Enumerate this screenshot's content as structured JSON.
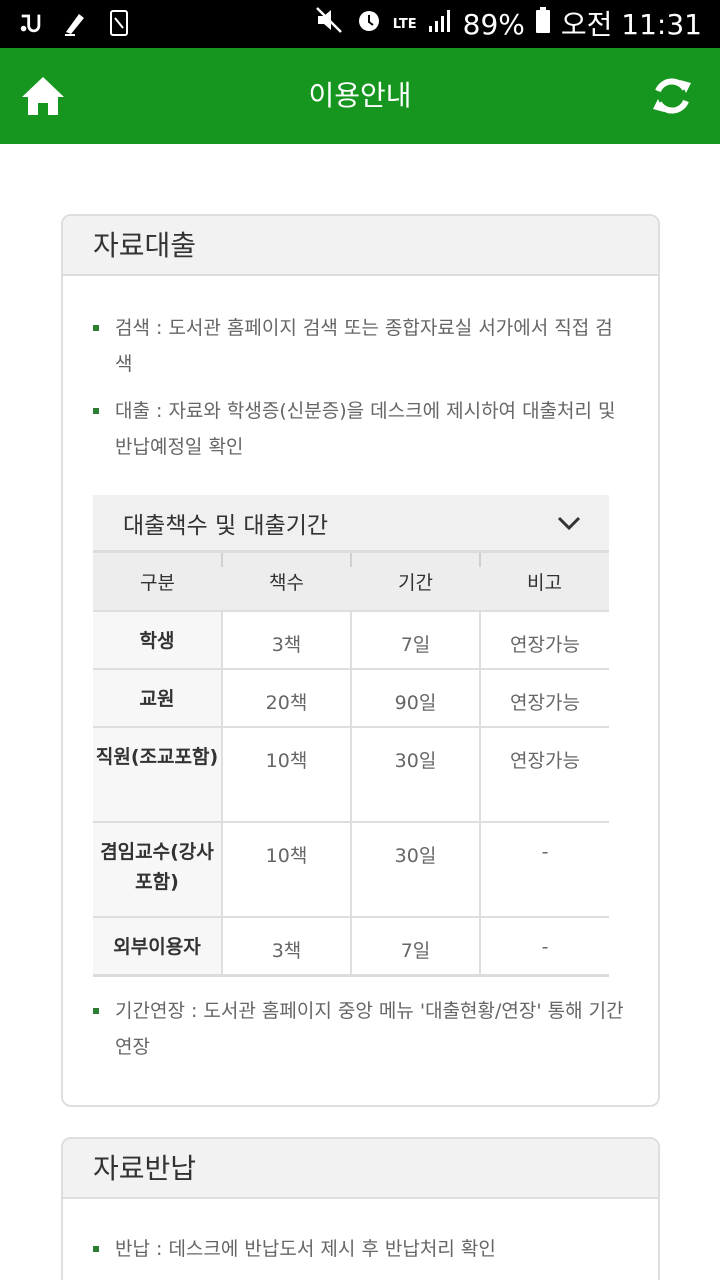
{
  "statusbar": {
    "battery": "89%",
    "time": "오전 11:31",
    "network": "LTE"
  },
  "appbar": {
    "title": "이용안내",
    "home_icon": "home-icon",
    "refresh_icon": "refresh-icon",
    "color": "#16961e"
  },
  "loan": {
    "title": "자료대출",
    "bullets": [
      "검색 : 도서관 홈페이지 검색 또는 종합자료실 서가에서 직접 검색",
      "대출 : 자료와 학생증(신분증)을 데스크에 제시하여 대출처리 및 반납예정일 확인"
    ],
    "accordion_title": "대출책수 및 대출기간",
    "table": {
      "headers": [
        "구분",
        "책수",
        "기간",
        "비고"
      ],
      "rows": [
        [
          "학생",
          "3책",
          "7일",
          "연장가능"
        ],
        [
          "교원",
          "20책",
          "90일",
          "연장가능"
        ],
        [
          "직원(조교포함)",
          "10책",
          "30일",
          "연장가능"
        ],
        [
          "겸임교수(강사포함)",
          "10책",
          "30일",
          "-"
        ],
        [
          "외부이용자",
          "3책",
          "7일",
          "-"
        ]
      ]
    },
    "extension": "기간연장 : 도서관 홈페이지 중앙 메뉴 '대출현황/연장' 통해 기간연장"
  },
  "return": {
    "title": "자료반납",
    "bullets": [
      "반납 : 데스크에 반납도서 제시 후 반납처리 확인"
    ]
  }
}
